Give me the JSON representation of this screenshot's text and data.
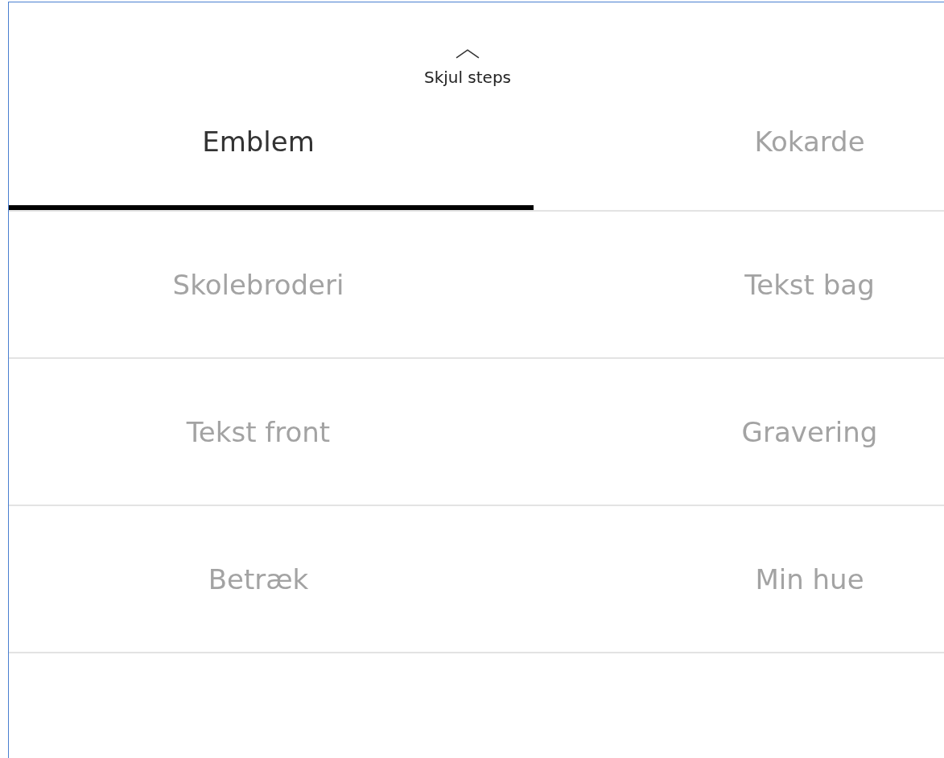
{
  "toggle": {
    "label": "Skjul steps",
    "expanded": true
  },
  "steps": [
    {
      "label": "Emblem",
      "selected": true
    },
    {
      "label": "Kokarde",
      "selected": false
    },
    {
      "label": "Skolebroderi",
      "selected": false
    },
    {
      "label": "Tekst bag",
      "selected": false
    },
    {
      "label": "Tekst front",
      "selected": false
    },
    {
      "label": "Gravering",
      "selected": false
    },
    {
      "label": "Betræk",
      "selected": false
    },
    {
      "label": "Min hue",
      "selected": false
    }
  ]
}
